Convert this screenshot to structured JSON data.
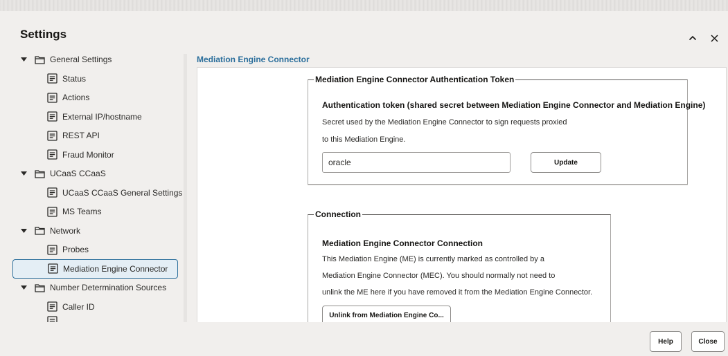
{
  "dialog": {
    "title": "Settings",
    "collapse_label": "collapse",
    "close_label": "close"
  },
  "tree": {
    "items": [
      {
        "label": "General Settings",
        "type": "folder"
      },
      {
        "label": "Status",
        "type": "page"
      },
      {
        "label": "Actions",
        "type": "page"
      },
      {
        "label": "External IP/hostname",
        "type": "page"
      },
      {
        "label": "REST API",
        "type": "page"
      },
      {
        "label": "Fraud Monitor",
        "type": "page"
      },
      {
        "label": "UCaaS CCaaS",
        "type": "folder"
      },
      {
        "label": "UCaaS CCaaS General Settings",
        "type": "page"
      },
      {
        "label": "MS Teams",
        "type": "page"
      },
      {
        "label": "Network",
        "type": "folder"
      },
      {
        "label": "Probes",
        "type": "page"
      },
      {
        "label": "Mediation Engine Connector",
        "type": "page",
        "selected": true
      },
      {
        "label": "Number Determination Sources",
        "type": "folder"
      },
      {
        "label": "Caller ID",
        "type": "page"
      }
    ]
  },
  "content": {
    "breadcrumb": "Mediation Engine Connector",
    "auth_group": {
      "legend": "Mediation Engine Connector Authentication Token",
      "title": "Authentication token (shared secret between Mediation Engine Connector and Mediation Engine)",
      "line1": "Secret used by the Mediation Engine Connector to sign requests proxied",
      "line2": "to this Mediation Engine.",
      "token_value": "oracle",
      "update_label": "Update"
    },
    "connection_group": {
      "legend": "Connection",
      "title": "Mediation Engine Connector Connection",
      "line1": "This Mediation Engine (ME) is currently marked as controlled by a",
      "line2": "Mediation Engine Connector (MEC). You should normally not need to",
      "line3": "unlink the ME here if you have removed it from the Mediation Engine Connector.",
      "unlink_label": "Unlink from Mediation Engine Co..."
    }
  },
  "footer": {
    "help_label": "Help",
    "close_label": "Close"
  },
  "icons": {
    "folder": "folder-icon",
    "page": "page-icon",
    "caret": "caret-down-icon"
  },
  "colors": {
    "accent": "#2c6f9c",
    "background": "#f1efed",
    "selected_bg": "#e4eef5"
  }
}
